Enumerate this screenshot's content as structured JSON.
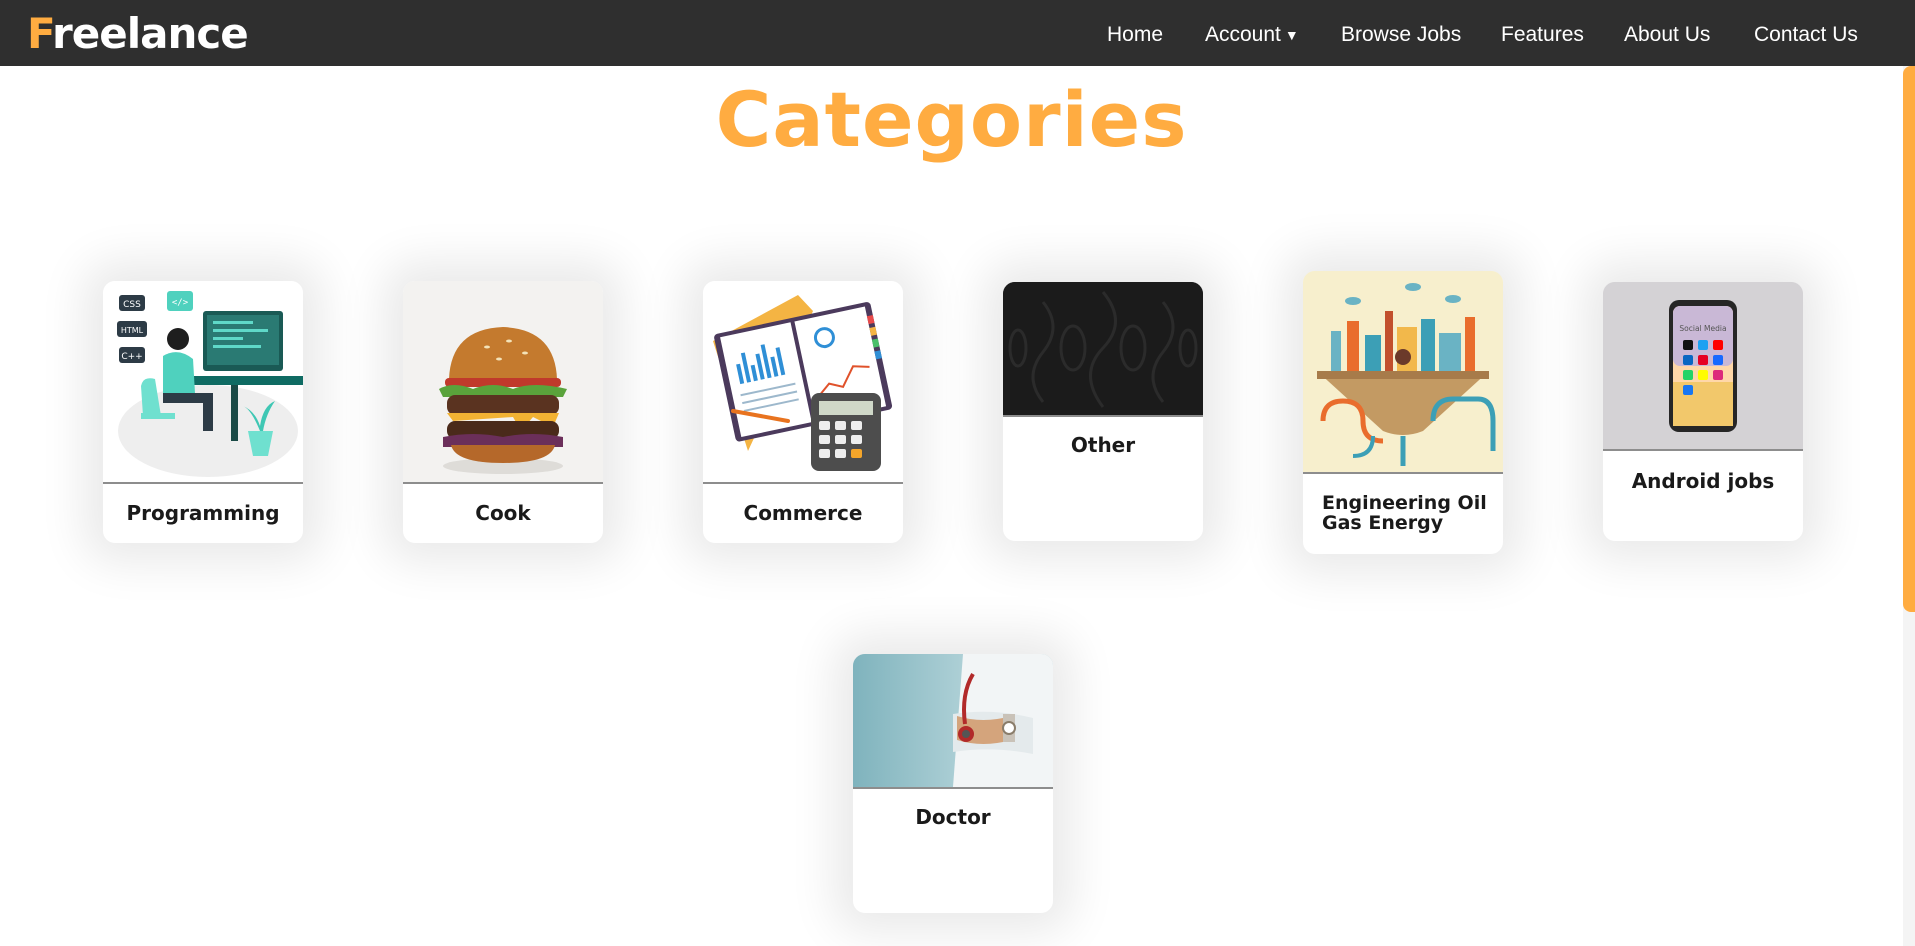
{
  "brand": {
    "first_letter": "F",
    "rest": "reelance"
  },
  "nav": {
    "home": "Home",
    "account": "Account",
    "browse_jobs": "Browse Jobs",
    "features": "Features",
    "about_us": "About Us",
    "contact_us": "Contact Us"
  },
  "page": {
    "title": "Categories"
  },
  "categories": [
    {
      "title": "Programming",
      "image_icons": [
        "CSS",
        "HTML",
        "C++",
        "</>"
      ]
    },
    {
      "title": "Cook"
    },
    {
      "title": "Commerce"
    },
    {
      "title": "Other"
    },
    {
      "title": "Engineering Oil Gas Energy"
    },
    {
      "title": "Android jobs",
      "phone_header": "Social Media"
    },
    {
      "title": "Doctor"
    }
  ],
  "colors": {
    "accent": "#ffac41",
    "navbar": "#2f2f2f",
    "text": "#1a1a1a"
  }
}
